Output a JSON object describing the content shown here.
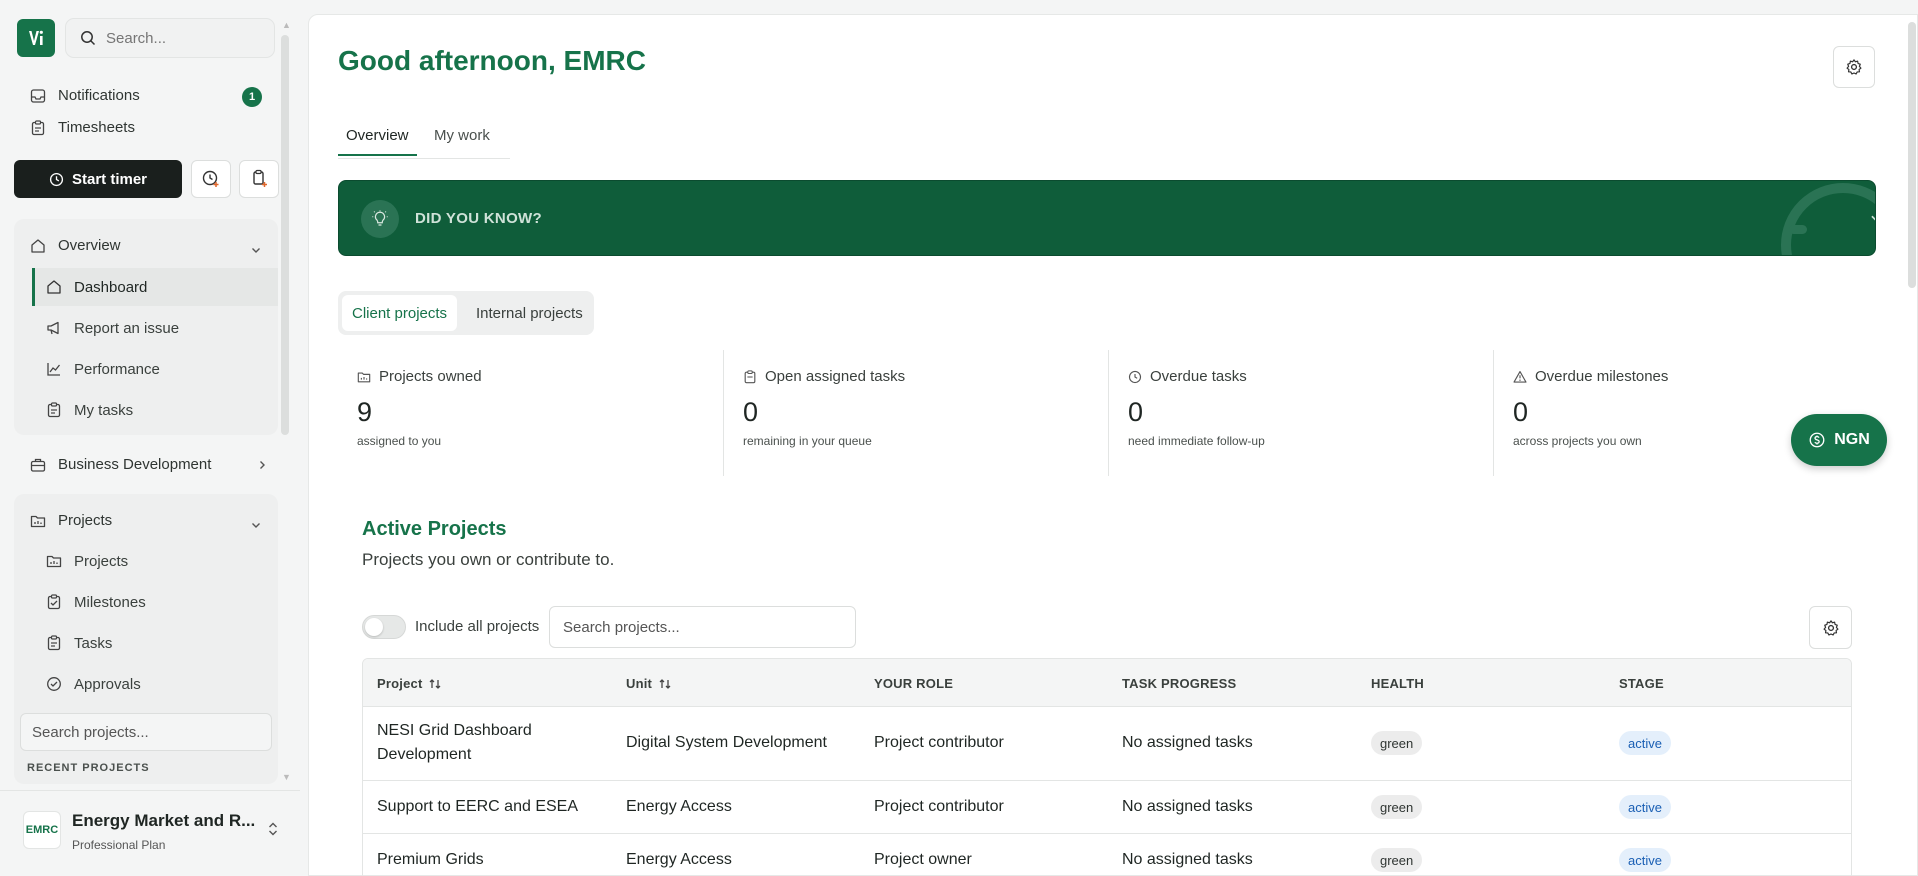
{
  "sidebar": {
    "search_placeholder": "Search...",
    "notifications_label": "Notifications",
    "notifications_count": "1",
    "timesheets_label": "Timesheets",
    "start_timer_label": "Start timer",
    "overview_group": {
      "label": "Overview",
      "items": [
        {
          "label": "Dashboard"
        },
        {
          "label": "Report an issue"
        },
        {
          "label": "Performance"
        },
        {
          "label": "My tasks"
        }
      ]
    },
    "business_dev_label": "Business Development",
    "projects_group": {
      "label": "Projects",
      "items": [
        {
          "label": "Projects"
        },
        {
          "label": "Milestones"
        },
        {
          "label": "Tasks"
        },
        {
          "label": "Approvals"
        }
      ]
    },
    "search_projects_placeholder": "Search projects...",
    "recent_projects_label": "RECENT PROJECTS",
    "org": {
      "logo_text": "EMRC",
      "name": "Energy Market and R...",
      "plan": "Professional Plan"
    }
  },
  "main": {
    "greeting": "Good afternoon, EMRC",
    "tabs": [
      {
        "label": "Overview"
      },
      {
        "label": "My work"
      }
    ],
    "did_you_know": "DID YOU KNOW?",
    "segments": [
      {
        "label": "Client projects"
      },
      {
        "label": "Internal projects"
      }
    ],
    "stats": [
      {
        "title": "Projects owned",
        "value": "9",
        "sub": "assigned to you"
      },
      {
        "title": "Open assigned tasks",
        "value": "0",
        "sub": "remaining in your queue"
      },
      {
        "title": "Overdue tasks",
        "value": "0",
        "sub": "need immediate follow-up"
      },
      {
        "title": "Overdue milestones",
        "value": "0",
        "sub": "across projects you own"
      }
    ],
    "currency_button": "NGN",
    "active_projects": {
      "title": "Active Projects",
      "subtitle": "Projects you own or contribute to.",
      "include_all_label": "Include all projects",
      "search_placeholder": "Search projects..."
    },
    "table": {
      "headers": [
        "Project",
        "Unit",
        "YOUR ROLE",
        "TASK PROGRESS",
        "HEALTH",
        "STAGE"
      ],
      "rows": [
        {
          "project": "NESI Grid Dashboard Development",
          "unit": "Digital System Development",
          "role": "Project contributor",
          "progress": "No assigned tasks",
          "health": "green",
          "stage": "active"
        },
        {
          "project": "Support to EERC and ESEA",
          "unit": "Energy Access",
          "role": "Project contributor",
          "progress": "No assigned tasks",
          "health": "green",
          "stage": "active"
        },
        {
          "project": "Premium Grids",
          "unit": "Energy Access",
          "role": "Project owner",
          "progress": "No assigned tasks",
          "health": "green",
          "stage": "active"
        }
      ]
    }
  },
  "colors": {
    "brand": "#16734a",
    "banner": "#0f5d3a"
  }
}
